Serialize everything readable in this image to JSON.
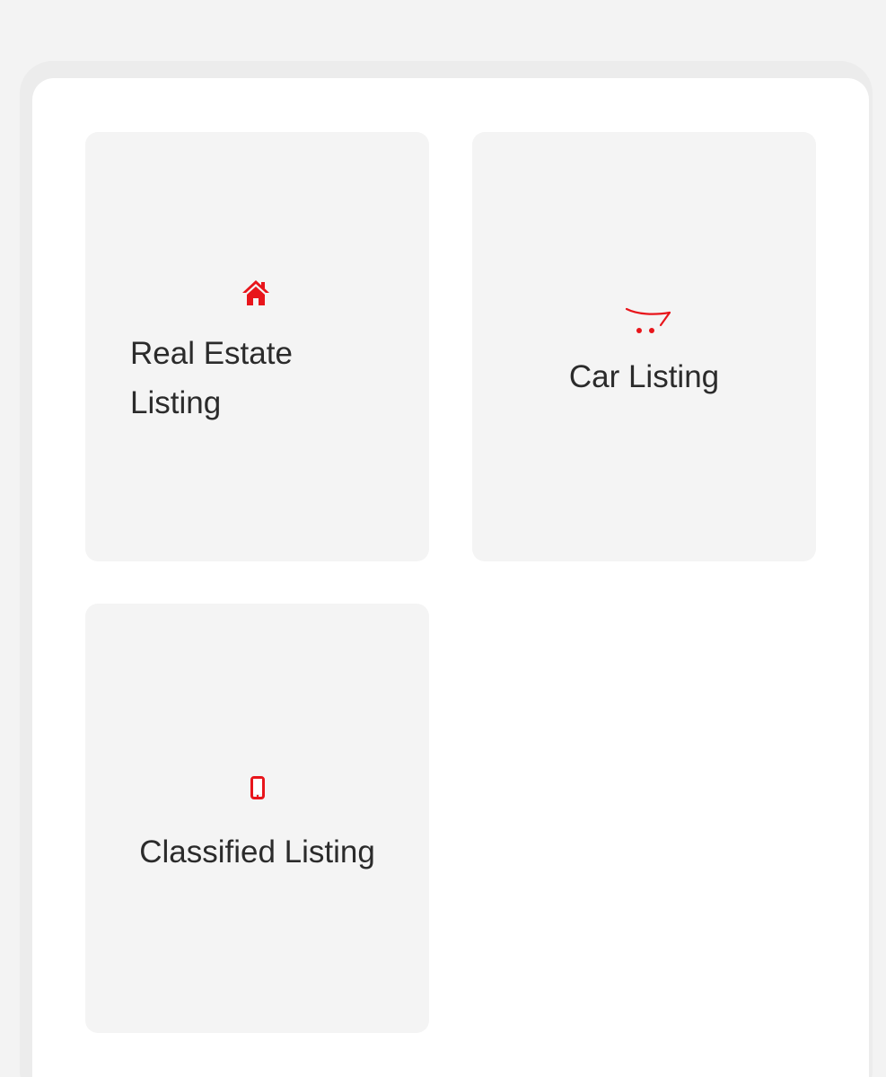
{
  "accent_color": "#e8151b",
  "cards": [
    {
      "label": "Real Estate Listing",
      "icon": "home-icon"
    },
    {
      "label": "Car Listing",
      "icon": "cart-icon"
    },
    {
      "label": "Classified Listing",
      "icon": "mobile-phone-icon"
    }
  ]
}
